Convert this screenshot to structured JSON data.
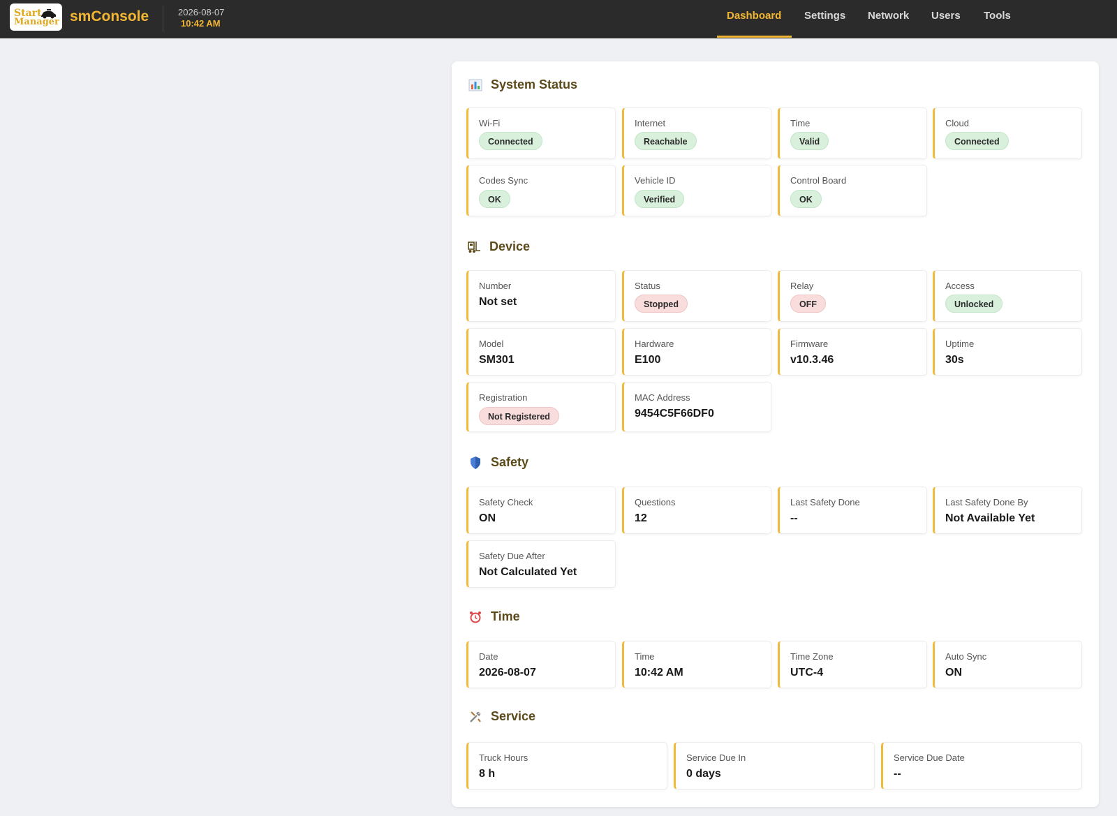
{
  "header": {
    "logo_line1": "Start",
    "logo_line2": "Manager",
    "brand": "smConsole",
    "date": "2026-08-07",
    "time": "10:42 AM"
  },
  "nav": {
    "items": [
      "Dashboard",
      "Settings",
      "Network",
      "Users",
      "Tools"
    ],
    "active": "Dashboard"
  },
  "colors": {
    "accent": "#f3b632",
    "topbar": "#2b2b2b",
    "badge_green": "#d9f0dc",
    "badge_red": "#f9dcdc",
    "card_border": "#f0bb3a"
  },
  "sections": {
    "system_status": {
      "title": "System Status",
      "icon": "bar-chart-icon",
      "cards": [
        {
          "label": "Wi-Fi",
          "value": "Connected",
          "kind": "badge",
          "tone": "green"
        },
        {
          "label": "Internet",
          "value": "Reachable",
          "kind": "badge",
          "tone": "green"
        },
        {
          "label": "Time",
          "value": "Valid",
          "kind": "badge",
          "tone": "green"
        },
        {
          "label": "Cloud",
          "value": "Connected",
          "kind": "badge",
          "tone": "green"
        },
        {
          "label": "Codes Sync",
          "value": "OK",
          "kind": "badge",
          "tone": "green"
        },
        {
          "label": "Vehicle ID",
          "value": "Verified",
          "kind": "badge",
          "tone": "green"
        },
        {
          "label": "Control Board",
          "value": "OK",
          "kind": "badge",
          "tone": "green"
        }
      ]
    },
    "device": {
      "title": "Device",
      "icon": "forklift-icon",
      "cards": [
        {
          "label": "Number",
          "value": "Not set",
          "kind": "text"
        },
        {
          "label": "Status",
          "value": "Stopped",
          "kind": "badge",
          "tone": "red"
        },
        {
          "label": "Relay",
          "value": "OFF",
          "kind": "badge",
          "tone": "red"
        },
        {
          "label": "Access",
          "value": "Unlocked",
          "kind": "badge",
          "tone": "green"
        },
        {
          "label": "Model",
          "value": "SM301",
          "kind": "text"
        },
        {
          "label": "Hardware",
          "value": "E100",
          "kind": "text"
        },
        {
          "label": "Firmware",
          "value": "v10.3.46",
          "kind": "text"
        },
        {
          "label": "Uptime",
          "value": "30s",
          "kind": "text"
        },
        {
          "label": "Registration",
          "value": "Not Registered",
          "kind": "badge",
          "tone": "red"
        },
        {
          "label": "MAC Address",
          "value": "9454C5F66DF0",
          "kind": "text"
        }
      ]
    },
    "safety": {
      "title": "Safety",
      "icon": "shield-icon",
      "cards": [
        {
          "label": "Safety Check",
          "value": "ON",
          "kind": "text"
        },
        {
          "label": "Questions",
          "value": "12",
          "kind": "text"
        },
        {
          "label": "Last Safety Done",
          "value": "--",
          "kind": "text"
        },
        {
          "label": "Last Safety Done By",
          "value": "Not Available Yet",
          "kind": "text"
        },
        {
          "label": "Safety Due After",
          "value": "Not Calculated Yet",
          "kind": "text"
        }
      ]
    },
    "time": {
      "title": "Time",
      "icon": "alarm-clock-icon",
      "cards": [
        {
          "label": "Date",
          "value": "2026-08-07",
          "kind": "text"
        },
        {
          "label": "Time",
          "value": "10:42 AM",
          "kind": "text"
        },
        {
          "label": "Time Zone",
          "value": "UTC-4",
          "kind": "text"
        },
        {
          "label": "Auto Sync",
          "value": "ON",
          "kind": "text"
        }
      ]
    },
    "service": {
      "title": "Service",
      "icon": "tools-icon",
      "cards": [
        {
          "label": "Truck Hours",
          "value": "8 h",
          "kind": "text"
        },
        {
          "label": "Service Due In",
          "value": "0 days",
          "kind": "text"
        },
        {
          "label": "Service Due Date",
          "value": "--",
          "kind": "text"
        }
      ]
    }
  }
}
